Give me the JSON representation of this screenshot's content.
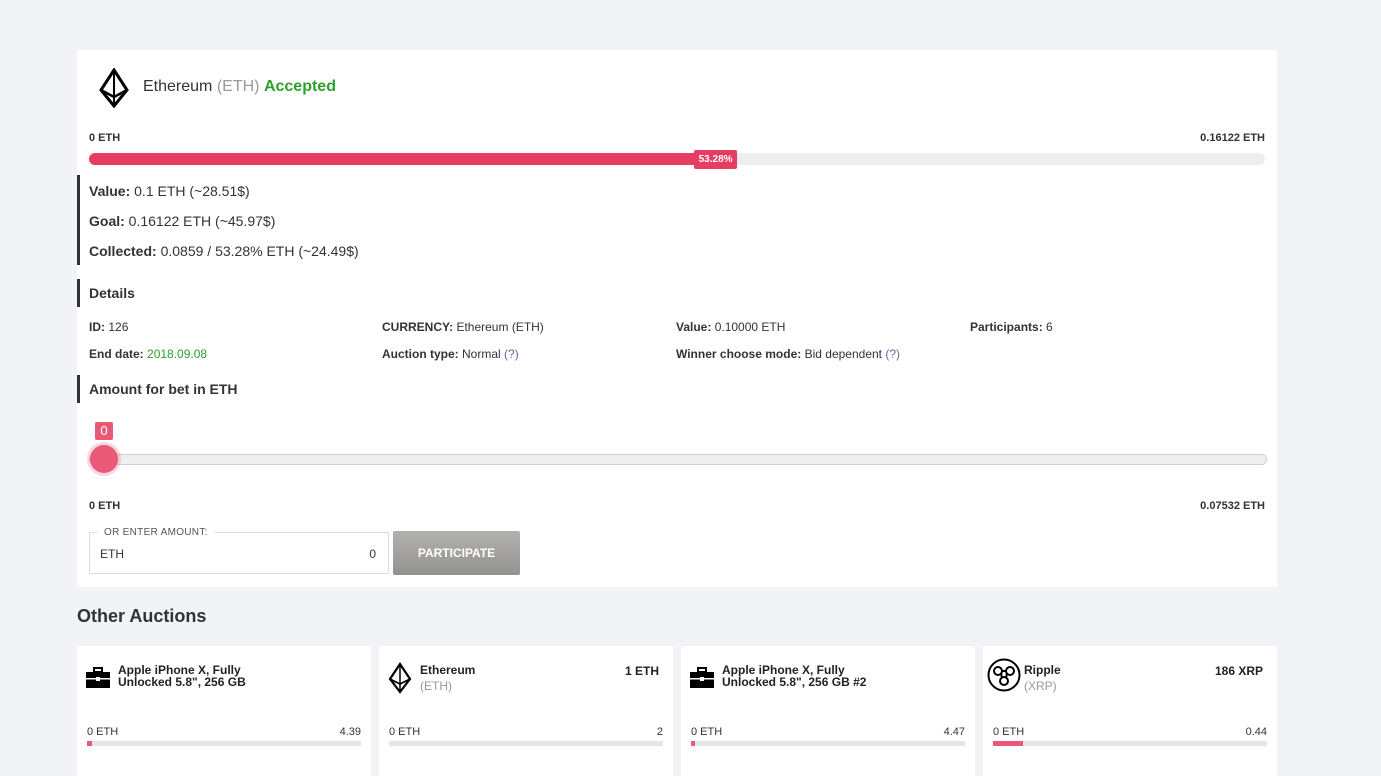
{
  "auction": {
    "currency_name": "Ethereum",
    "currency_symbol": "(ETH)",
    "status": "Accepted",
    "range_min": "0 ETH",
    "range_max": "0.16122 ETH",
    "progress_percent": 53.28,
    "progress_label": "53.28%",
    "value_label": "Value:",
    "value_text": "0.1 ETH (~28.51$)",
    "goal_label": "Goal:",
    "goal_text": "0.16122 ETH (~45.97$)",
    "collected_label": "Collected:",
    "collected_text": "0.0859 / 53.28% ETH (~24.49$)"
  },
  "details": {
    "heading": "Details",
    "id_label": "ID:",
    "id_value": "126",
    "currency_label": "CURRENCY:",
    "currency_value": "Ethereum (ETH)",
    "value_label": "Value:",
    "value_value": "0.10000 ETH",
    "participants_label": "Participants:",
    "participants_value": "6",
    "end_date_label": "End date:",
    "end_date_value": "2018.09.08",
    "auction_type_label": "Auction type:",
    "auction_type_value": "Normal",
    "auction_type_help": "(?)",
    "winner_mode_label": "Winner choose mode:",
    "winner_mode_value": "Bid dependent",
    "winner_mode_help": "(?)"
  },
  "bet": {
    "heading": "Amount for bet in ETH",
    "slider_value": "0",
    "slider_min": "0 ETH",
    "slider_max": "0.07532 ETH",
    "enter_legend": "OR ENTER AMOUNT:",
    "currency": "ETH",
    "input_value": "0",
    "participate_label": "PARTICIPATE"
  },
  "other": {
    "heading": "Other Auctions",
    "items": [
      {
        "name": "Apple iPhone X, Fully Unlocked 5.8\", 256 GB",
        "symbol": "",
        "price": "",
        "lo": "0 ETH",
        "hi": "4.39",
        "fill": 0.02,
        "icon": "briefcase-icon"
      },
      {
        "name": "Ethereum",
        "symbol": "(ETH)",
        "price": "1 ETH",
        "lo": "0 ETH",
        "hi": "2",
        "fill": 0.0,
        "icon": "ethereum-icon"
      },
      {
        "name": "Apple iPhone X, Fully Unlocked 5.8\", 256 GB #2",
        "symbol": "",
        "price": "",
        "lo": "0 ETH",
        "hi": "4.47",
        "fill": 0.015,
        "icon": "briefcase-icon"
      },
      {
        "name": "Ripple",
        "symbol": "(XRP)",
        "price": "186 XRP",
        "lo": "0 ETH",
        "hi": "0.44",
        "fill": 0.11,
        "icon": "ripple-icon"
      }
    ]
  },
  "colors": {
    "accent": "#e63d62",
    "success": "#2ca02c",
    "background": "#f2f3f7"
  }
}
